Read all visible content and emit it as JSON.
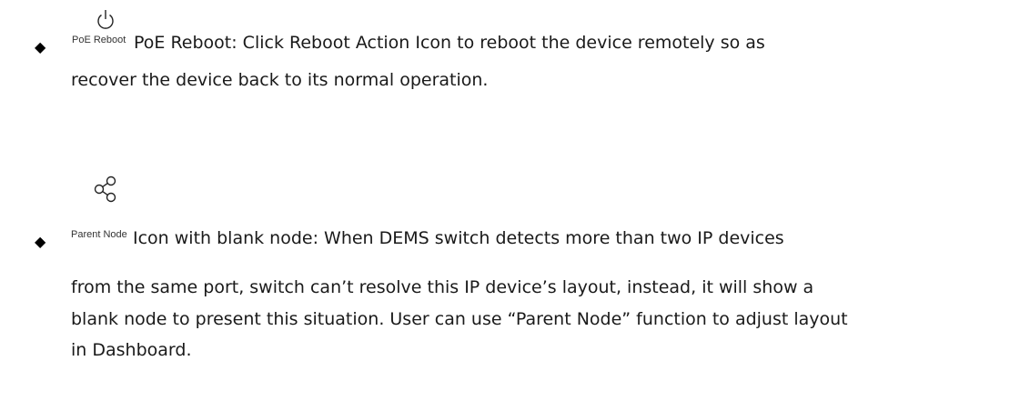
{
  "items": [
    {
      "icon_name": "power-icon",
      "icon_label": "PoE Reboot",
      "lines": [
        "PoE Reboot: Click Reboot Action Icon to reboot the device remotely so as",
        "recover the device back to its normal operation."
      ]
    },
    {
      "icon_name": "share-node-icon",
      "icon_label": "Parent Node",
      "lines": [
        "Icon with blank node: When DEMS switch detects more than two IP devices",
        "from the same port, switch can’t resolve this IP device’s layout, instead, it will show a",
        "blank node to present this situation. User can use “Parent Node” function to adjust layout",
        "in Dashboard."
      ]
    }
  ]
}
